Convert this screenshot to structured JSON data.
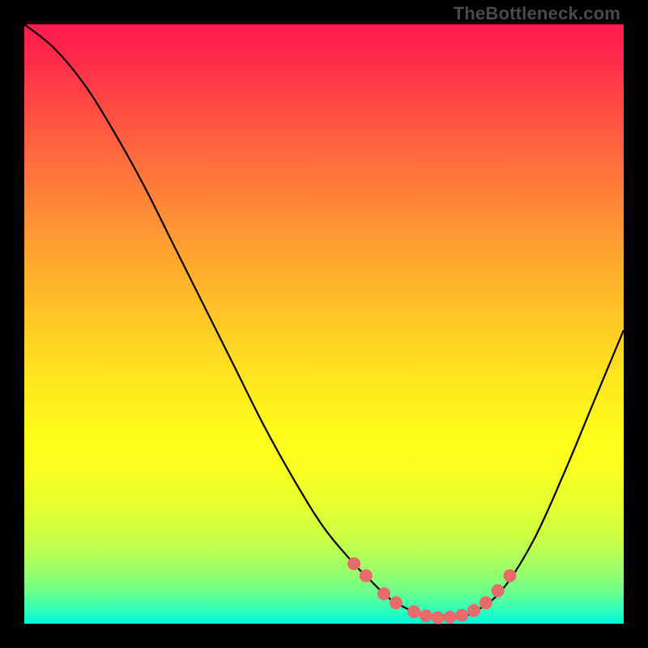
{
  "watermark": "TheBottleneck.com",
  "chart_data": {
    "type": "line",
    "title": "",
    "xlabel": "",
    "ylabel": "",
    "xlim": [
      0,
      100
    ],
    "ylim": [
      0,
      100
    ],
    "grid": false,
    "legend": false,
    "annotations": [],
    "background_gradient": {
      "top": "#ff1a4d",
      "mid": "#ffe81e",
      "bottom": "#00f7d8"
    },
    "series": [
      {
        "name": "bottleneck-curve",
        "color": "#000000",
        "x": [
          0,
          5,
          10,
          15,
          20,
          25,
          30,
          35,
          40,
          45,
          50,
          55,
          57,
          60,
          62,
          65,
          68,
          70,
          73,
          76,
          80,
          85,
          90,
          95,
          100
        ],
        "y": [
          100,
          96,
          90,
          82,
          73,
          63,
          53,
          43,
          33,
          24,
          16,
          10,
          8,
          5,
          3.5,
          2,
          1.2,
          1,
          1.2,
          2.5,
          6,
          14,
          25,
          37,
          49
        ]
      }
    ],
    "markers": {
      "name": "valley-points",
      "color": "#e86a6a",
      "x": [
        55,
        57,
        60,
        62,
        65,
        67,
        69,
        71,
        73,
        75,
        77,
        79,
        81
      ],
      "y": [
        10,
        8,
        5,
        3.5,
        2,
        1.3,
        1,
        1.1,
        1.4,
        2.2,
        3.5,
        5.5,
        8
      ]
    }
  }
}
